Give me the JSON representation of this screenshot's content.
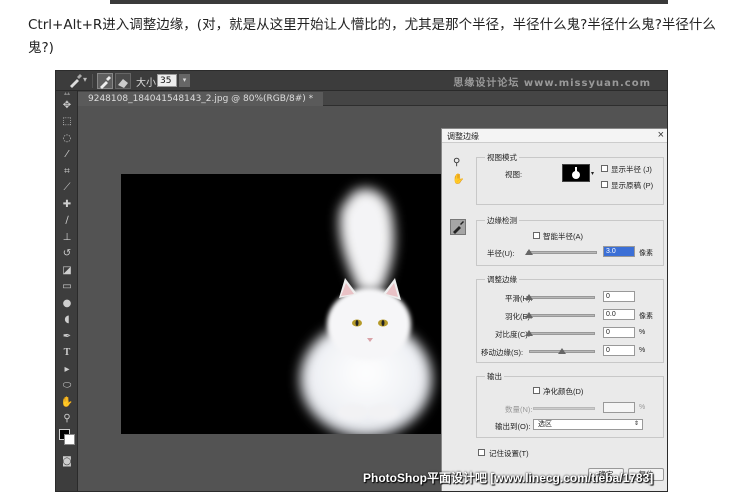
{
  "article": {
    "text": "Ctrl+Alt+R进入调整边缘，(对，就是从这里开始让人懵比的，尤其是那个半径，半径什么鬼?半径什么鬼?半径什么鬼?)"
  },
  "options_bar": {
    "size_label": "大小:",
    "size_value": "35",
    "forum_watermark": "思缘设计论坛 www.missyuan.com"
  },
  "document": {
    "tab_title": "9248108_184041548143_2.jpg @ 80%(RGB/8#) *"
  },
  "tools": [
    "move",
    "marquee",
    "lasso",
    "quick-select",
    "crop",
    "eyedropper",
    "healing",
    "brush",
    "stamp",
    "history-brush",
    "eraser",
    "gradient",
    "blur",
    "dodge",
    "pen",
    "type",
    "path-select",
    "shape",
    "hand",
    "zoom"
  ],
  "dialog": {
    "title": "调整边缘",
    "view_mode": {
      "section": "视图模式",
      "view_label": "视图:",
      "show_radius": "显示半径 (J)",
      "show_original": "显示原稿 (P)"
    },
    "edge_detection": {
      "section": "边缘检测",
      "smart_radius": "智能半径(A)",
      "radius_label": "半径(U):",
      "radius_value": "3.0",
      "radius_unit": "像素",
      "radius_fraction": 0.03
    },
    "adjust_edge": {
      "section": "调整边缘",
      "smooth_label": "平滑(H):",
      "smooth_value": "0",
      "feather_label": "羽化(E):",
      "feather_value": "0.0",
      "feather_unit": "像素",
      "contrast_label": "对比度(C):",
      "contrast_value": "0",
      "contrast_unit": "%",
      "shift_label": "移动边缘(S):",
      "shift_value": "0",
      "shift_unit": "%",
      "shift_fraction": 0.5
    },
    "output": {
      "section": "输出",
      "decontaminate": "净化颜色(D)",
      "amount_label": "数量(N):",
      "amount_unit": "%",
      "output_to_label": "输出到(O):",
      "output_to_value": "选区"
    },
    "remember": "记住设置(T)",
    "ok": "确定",
    "reset": "复位"
  },
  "bottom_watermark": "PhotoShop平面设计吧 [www.linecg.com/tieba/1783]"
}
